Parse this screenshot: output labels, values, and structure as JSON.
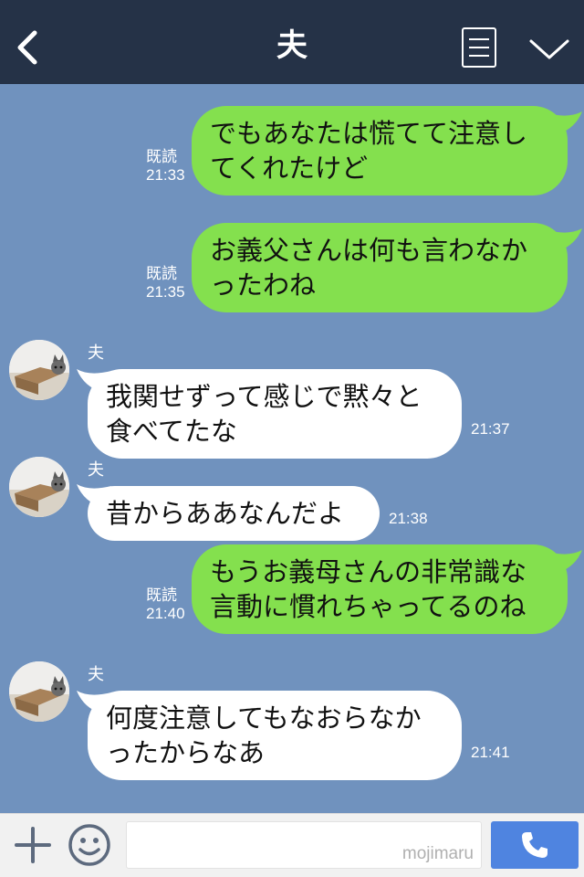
{
  "header": {
    "title": "夫",
    "back_icon": "chevron-left-icon",
    "menu_icon": "menu-icon",
    "collapse_icon": "chevron-down-icon"
  },
  "messages": [
    {
      "direction": "out",
      "lines": [
        "でもあなたは慌てて注意し",
        "てくれたけど"
      ],
      "read": "既読",
      "time": "21:33"
    },
    {
      "direction": "out",
      "lines": [
        "お義父さんは何も言わなか",
        "ったわね"
      ],
      "read": "既読",
      "time": "21:35"
    },
    {
      "direction": "in",
      "sender": "夫",
      "lines": [
        "我関せずって感じで黙々と",
        "食べてたな"
      ],
      "time": "21:37"
    },
    {
      "direction": "in",
      "sender": "夫",
      "lines": [
        "昔からああなんだよ"
      ],
      "time": "21:38"
    },
    {
      "direction": "out",
      "lines": [
        "もうお義母さんの非常識な",
        "言動に慣れちゃってるのね"
      ],
      "read": "既読",
      "time": "21:40"
    },
    {
      "direction": "in",
      "sender": "夫",
      "lines": [
        "何度注意してもなおらなか",
        "ったからなあ"
      ],
      "time": "21:41"
    }
  ],
  "footer": {
    "plus_icon": "plus-icon",
    "emoji_icon": "smiley-icon",
    "input_value": "",
    "watermark": "mojimaru",
    "call_icon": "phone-icon"
  },
  "colors": {
    "header_bg": "#253247",
    "chat_bg": "#7092be",
    "outgoing_bubble": "#84e04e",
    "incoming_bubble": "#ffffff",
    "call_button": "#4f84e0"
  }
}
